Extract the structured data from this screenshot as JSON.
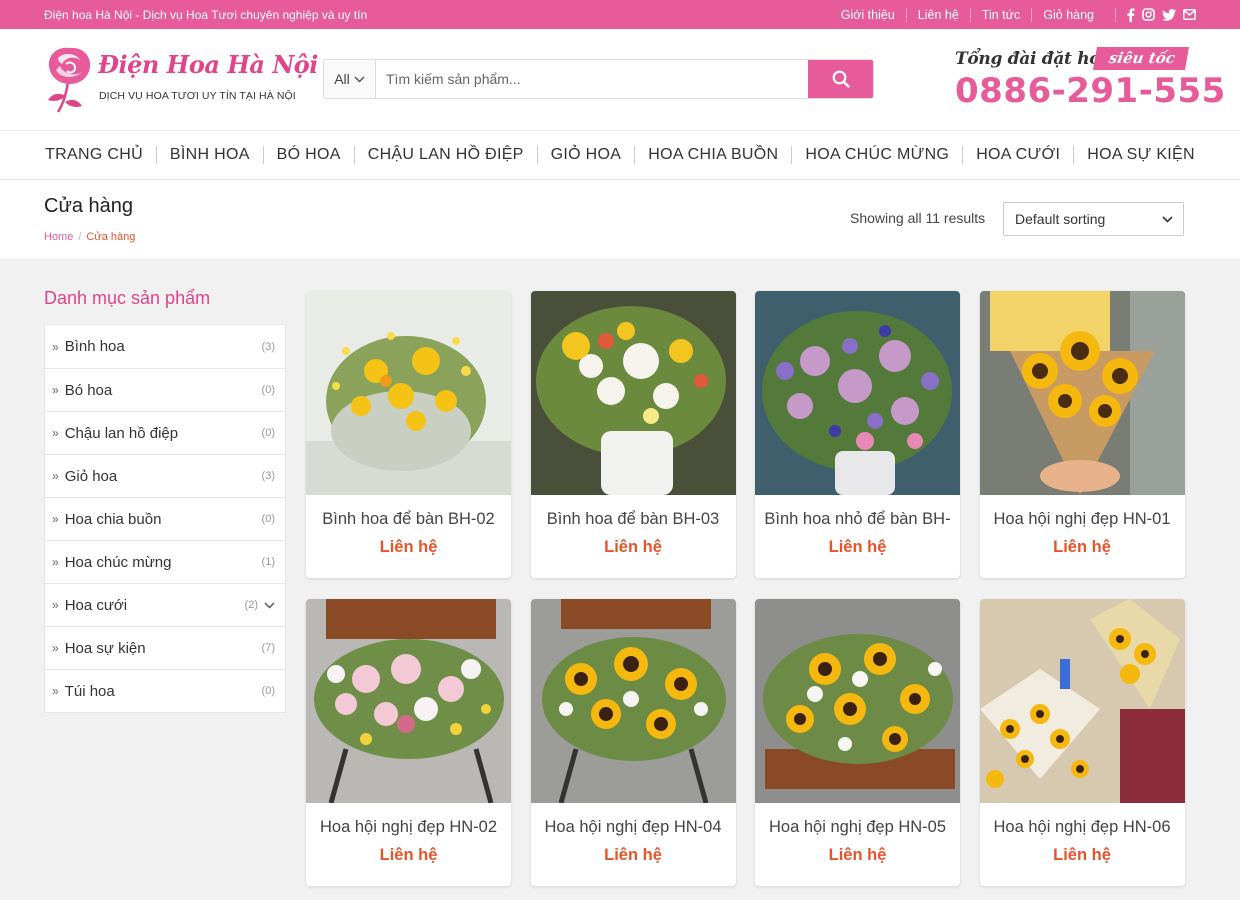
{
  "topbar": {
    "tagline": "Điện hoa Hà Nội - Dịch vụ Hoa Tươi chuyên nghiệp và uy tín",
    "links": [
      "Giới thiệu",
      "Liên hệ",
      "Tin tức",
      "Giỏ hàng"
    ],
    "social_icons": [
      "facebook-icon",
      "instagram-icon",
      "twitter-icon",
      "email-icon"
    ]
  },
  "header": {
    "logo_title": "Điện Hoa Hà Nội",
    "logo_subtitle": "DỊCH VỤ HOA TƯƠI UY TÍN TẠI HÀ NỘI",
    "search_category": "All",
    "search_placeholder": "Tìm kiếm sản phẩm...",
    "hotline_label": "Tổng đài đặt hoa",
    "hotline_badge": "siêu tốc",
    "hotline_phone": "0886-291-555"
  },
  "nav": [
    "TRANG CHỦ",
    "BÌNH HOA",
    "BÓ HOA",
    "CHẬU LAN HỒ ĐIỆP",
    "GIỎ HOA",
    "HOA CHIA BUỒN",
    "HOA CHÚC MỪNG",
    "HOA CƯỚI",
    "HOA SỰ KIỆN"
  ],
  "page": {
    "title": "Cửa hàng",
    "breadcrumb_home": "Home",
    "breadcrumb_sep": "/",
    "breadcrumb_current": "Cửa hàng",
    "result_count": "Showing all 11 results",
    "sort_value": "Default sorting"
  },
  "sidebar": {
    "heading": "Danh mục sản phẩm",
    "categories": [
      {
        "name": "Bình hoa",
        "count": "(3)"
      },
      {
        "name": "Bó hoa",
        "count": "(0)"
      },
      {
        "name": "Chậu lan hồ điệp",
        "count": "(0)"
      },
      {
        "name": "Giỏ hoa",
        "count": "(3)"
      },
      {
        "name": "Hoa chia buồn",
        "count": "(0)"
      },
      {
        "name": "Hoa chúc mừng",
        "count": "(1)"
      },
      {
        "name": "Hoa cưới",
        "count": "(2)"
      },
      {
        "name": "Hoa sự kiện",
        "count": "(7)"
      },
      {
        "name": "Túi hoa",
        "count": "(0)"
      }
    ]
  },
  "products": [
    {
      "name": "Bình hoa để bàn BH-02",
      "price": "Liên hệ"
    },
    {
      "name": "Bình hoa để bàn BH-03",
      "price": "Liên hệ"
    },
    {
      "name": "Bình hoa nhỏ để bàn BH-",
      "price": "Liên hệ"
    },
    {
      "name": "Hoa hội nghị đẹp HN-01",
      "price": "Liên hệ"
    },
    {
      "name": "Hoa hội nghị đẹp HN-02",
      "price": "Liên hệ"
    },
    {
      "name": "Hoa hội nghị đẹp HN-04",
      "price": "Liên hệ"
    },
    {
      "name": "Hoa hội nghị đẹp HN-05",
      "price": "Liên hệ"
    },
    {
      "name": "Hoa hội nghị đẹp HN-06",
      "price": "Liên hệ"
    }
  ],
  "colors": {
    "brand_pink": "#e85b9a",
    "price_orange": "#e8542a"
  }
}
